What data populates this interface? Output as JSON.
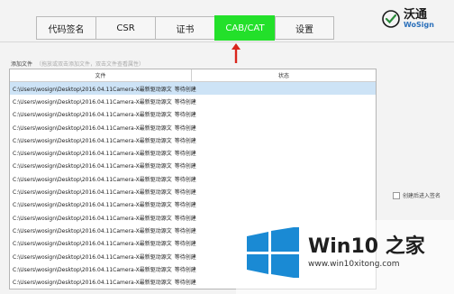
{
  "tabs": [
    {
      "label": "代码签名"
    },
    {
      "label": "CSR"
    },
    {
      "label": "证书"
    },
    {
      "label": "CAB/CAT",
      "active": true
    },
    {
      "label": "设置"
    }
  ],
  "logo": {
    "name": "沃通",
    "sub": "WoSign"
  },
  "add_files": {
    "label": "添加文件",
    "hint": "（拖放或双击添加文件，双击文件查看属性）"
  },
  "table": {
    "columns": [
      "文件",
      "状态"
    ],
    "rows": [
      {
        "path": "C:\\Users\\wosign\\Desktop\\2016.04.11Camera-X最新驱动源文",
        "status": "等待创建"
      },
      {
        "path": "C:\\Users\\wosign\\Desktop\\2016.04.11Camera-X最新驱动源文",
        "status": "等待创建"
      },
      {
        "path": "C:\\Users\\wosign\\Desktop\\2016.04.11Camera-X最新驱动源文",
        "status": "等待创建"
      },
      {
        "path": "C:\\Users\\wosign\\Desktop\\2016.04.11Camera-X最新驱动源文",
        "status": "等待创建"
      },
      {
        "path": "C:\\Users\\wosign\\Desktop\\2016.04.11Camera-X最新驱动源文",
        "status": "等待创建"
      },
      {
        "path": "C:\\Users\\wosign\\Desktop\\2016.04.11Camera-X最新驱动源文",
        "status": "等待创建"
      },
      {
        "path": "C:\\Users\\wosign\\Desktop\\2016.04.11Camera-X最新驱动源文",
        "status": "等待创建"
      },
      {
        "path": "C:\\Users\\wosign\\Desktop\\2016.04.11Camera-X最新驱动源文",
        "status": "等待创建"
      },
      {
        "path": "C:\\Users\\wosign\\Desktop\\2016.04.11Camera-X最新驱动源文",
        "status": "等待创建"
      },
      {
        "path": "C:\\Users\\wosign\\Desktop\\2016.04.11Camera-X最新驱动源文",
        "status": "等待创建"
      },
      {
        "path": "C:\\Users\\wosign\\Desktop\\2016.04.11Camera-X最新驱动源文",
        "status": "等待创建"
      },
      {
        "path": "C:\\Users\\wosign\\Desktop\\2016.04.11Camera-X最新驱动源文",
        "status": "等待创建"
      },
      {
        "path": "C:\\Users\\wosign\\Desktop\\2016.04.11Camera-X最新驱动源文",
        "status": "等待创建"
      },
      {
        "path": "C:\\Users\\wosign\\Desktop\\2016.04.11Camera-X最新驱动源文",
        "status": "等待创建"
      },
      {
        "path": "C:\\Users\\wosign\\Desktop\\2016.04.11Camera-X最新驱动源文",
        "status": "等待创建"
      },
      {
        "path": "C:\\Users\\wosign\\Desktop\\2016.04.11Camera-X最新驱动源文",
        "status": "等待创建"
      },
      {
        "path": "C:\\Users\\wosign\\Desktop\\2016.04.11Camera-X最新驱动源文",
        "status": "等待创建"
      }
    ]
  },
  "options": {
    "sign_after_create_label": "创建后进入签名",
    "sign_after_create_checked": false
  },
  "watermark": {
    "title": "Win10 之家",
    "url": "www.win10xitong.com"
  },
  "colors": {
    "active_tab": "#23e02a",
    "selected_row": "#cde3f6",
    "arrow": "#d9261c"
  }
}
